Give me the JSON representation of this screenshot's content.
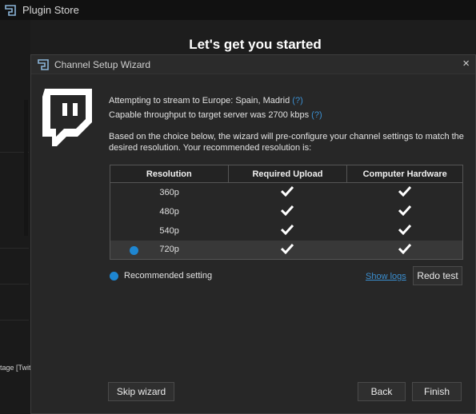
{
  "app": {
    "title": "Plugin Store",
    "heading": "Let's get you started",
    "sidebar_snippet": "tage [Twitch"
  },
  "dialog": {
    "title": "Channel Setup Wizard",
    "close_glyph": "×",
    "stream_target": "Attempting to stream to Europe: Spain, Madrid",
    "throughput": "Capable throughput to target server was 2700 kbps",
    "help_glyph": "(?)",
    "description": "Based on the choice below, the wizard will pre-configure your channel settings to match the desired resolution. Your recommended resolution is:",
    "table": {
      "headers": [
        "Resolution",
        "Required Upload",
        "Computer Hardware"
      ],
      "rows": [
        {
          "resolution": "360p",
          "upload_ok": true,
          "hardware_ok": true,
          "recommended": false
        },
        {
          "resolution": "480p",
          "upload_ok": true,
          "hardware_ok": true,
          "recommended": false
        },
        {
          "resolution": "540p",
          "upload_ok": true,
          "hardware_ok": true,
          "recommended": false
        },
        {
          "resolution": "720p",
          "upload_ok": true,
          "hardware_ok": true,
          "recommended": true
        }
      ]
    },
    "legend": "Recommended setting",
    "show_logs": "Show logs",
    "redo_test": "Redo test",
    "skip_wizard": "Skip wizard",
    "back": "Back",
    "finish": "Finish"
  },
  "colors": {
    "accent": "#1e86d1",
    "link": "#3b8fd1",
    "background": "#1d1d1d",
    "dialog": "#272727"
  },
  "icons": {
    "app_logo": "streamlabs-logo-icon",
    "brand": "twitch-logo-icon",
    "check": "checkmark-icon",
    "close": "close-icon"
  }
}
